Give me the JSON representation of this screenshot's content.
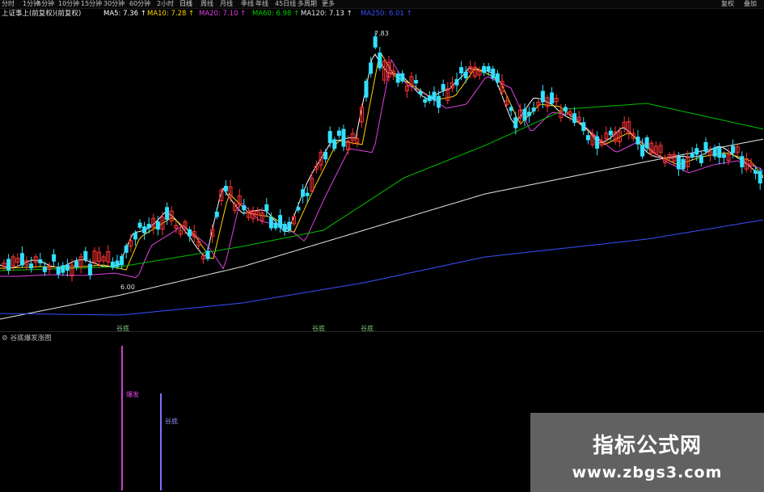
{
  "toolbar": {
    "tabs": [
      {
        "label": "分时"
      },
      {
        "label": "1分钟"
      },
      {
        "label": "5分钟"
      },
      {
        "label": "10分钟"
      },
      {
        "label": "15分钟"
      },
      {
        "label": "30分钟"
      },
      {
        "label": "60分钟"
      },
      {
        "label": "2小时"
      },
      {
        "label": "日线"
      },
      {
        "label": "周线"
      },
      {
        "label": "月线"
      },
      {
        "label": "季线"
      },
      {
        "label": "年线"
      },
      {
        "label": "45日线"
      },
      {
        "label": "多周期"
      },
      {
        "label": "更多"
      }
    ],
    "right_buttons": [
      "复权",
      "叠加"
    ]
  },
  "info": {
    "title": "上证事上(前复权)(前复权)",
    "ma": [
      {
        "text": "MA5: 7.36",
        "color": "#ffffff"
      },
      {
        "text": "MA10: 7.28",
        "color": "#ffd400"
      },
      {
        "text": "MA20: 7.10",
        "color": "#e040e0"
      },
      {
        "text": "MA60: 6.98",
        "color": "#00d000"
      },
      {
        "text": "MA120: 7.13",
        "color": "#e6e6e6"
      },
      {
        "text": "MA250: 6.01",
        "color": "#3a50ff"
      }
    ]
  },
  "price_labels": {
    "high": "7.83",
    "low": "6.00"
  },
  "signals": [
    {
      "text": "谷底",
      "color": "#7ec87e"
    },
    {
      "text": "谷底",
      "color": "#7ec87e"
    },
    {
      "text": "谷底",
      "color": "#7ec87e"
    }
  ],
  "subchart": {
    "title": "谷底爆发涨图",
    "bar_labels": [
      "爆发",
      "谷底"
    ]
  },
  "watermark": {
    "line1": "指标公式网",
    "line2": "www.zbgs3.com"
  },
  "colors": {
    "up": "#ff3333",
    "down": "#33e0ff",
    "ma5": "#ffffff",
    "ma10": "#ffd400",
    "ma20": "#e040e0",
    "ma60": "#00c000",
    "ma120": "#e6e6e6",
    "ma250": "#3a50ff"
  }
}
